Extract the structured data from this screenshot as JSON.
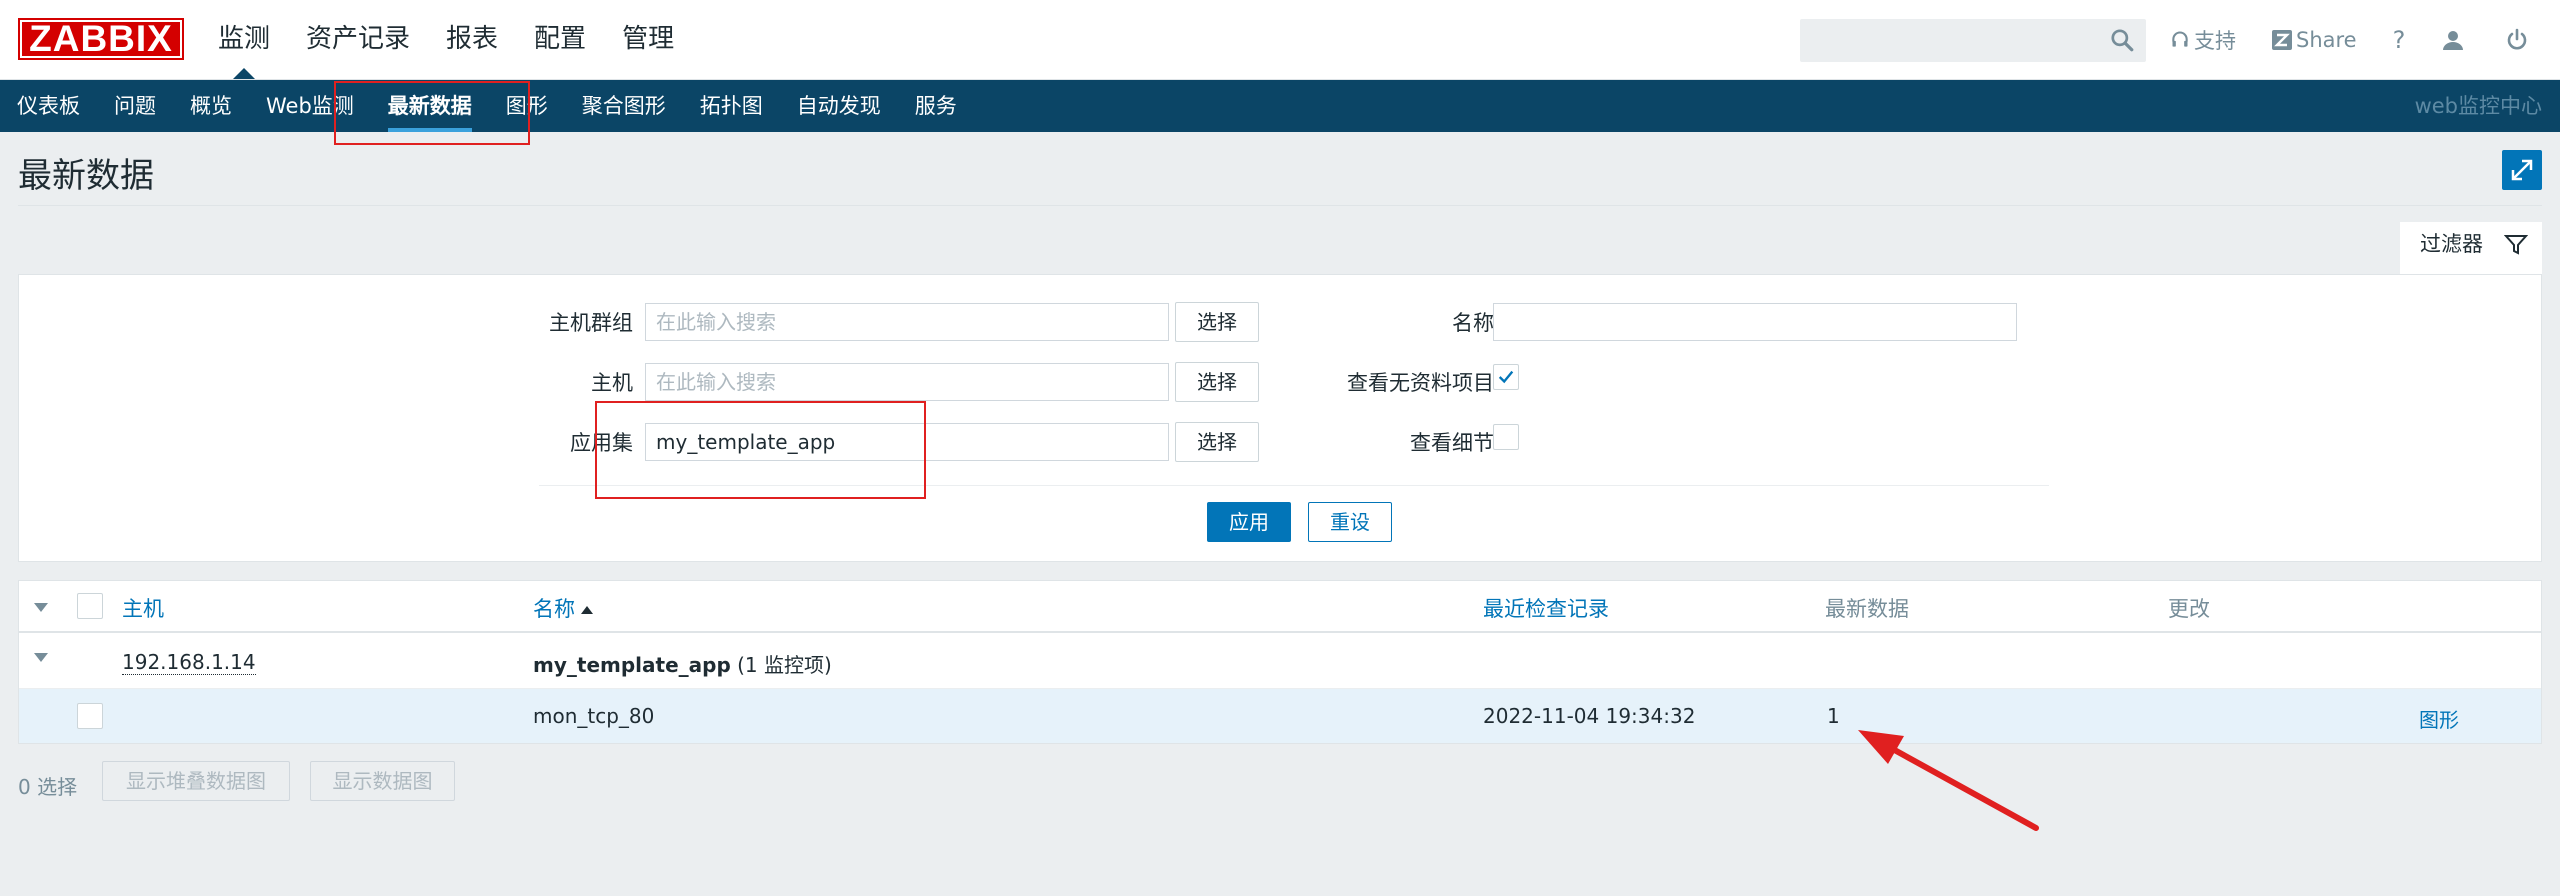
{
  "header": {
    "logo": "ZABBIX",
    "main_nav": [
      "监测",
      "资产记录",
      "报表",
      "配置",
      "管理"
    ],
    "support": "支持",
    "share": "Share",
    "help": "?"
  },
  "subnav": {
    "items": [
      "仪表板",
      "问题",
      "概览",
      "Web监测",
      "最新数据",
      "图形",
      "聚合图形",
      "拓扑图",
      "自动发现",
      "服务"
    ],
    "active": "最新数据",
    "right": "web监控中心"
  },
  "page": {
    "title": "最新数据"
  },
  "filter": {
    "tab_label": "过滤器",
    "host_group_label": "主机群组",
    "host_group_placeholder": "在此输入搜索",
    "host_label": "主机",
    "host_placeholder": "在此输入搜索",
    "app_label": "应用集",
    "app_value": "my_template_app",
    "select_label": "选择",
    "name_label": "名称",
    "name_value": "",
    "show_without_data_label": "查看无资料项目",
    "show_without_data_checked": true,
    "show_details_label": "查看细节",
    "show_details_checked": false,
    "apply": "应用",
    "reset": "重设"
  },
  "table": {
    "headers": {
      "host": "主机",
      "name": "名称",
      "last_check": "最近检查记录",
      "last_value": "最新数据",
      "change": "更改"
    },
    "group": {
      "host": "192.168.1.14",
      "app": "my_template_app",
      "count": "(1 监控项)"
    },
    "rows": [
      {
        "name": "mon_tcp_80",
        "last_check": "2022-11-04 19:34:32",
        "last_value": "1",
        "change": "",
        "graph": "图形"
      }
    ]
  },
  "footer": {
    "selected": "0 选择",
    "btn_stacked": "显示堆叠数据图",
    "btn_graph": "显示数据图"
  },
  "colors": {
    "brand_red": "#d40000",
    "nav_blue": "#0b4566",
    "accent": "#0275b8",
    "annotation": "#e02020"
  }
}
